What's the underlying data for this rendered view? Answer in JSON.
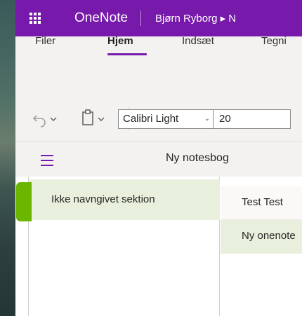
{
  "window": {
    "app_name": "OneNote",
    "breadcrumb": "Bjørn Ryborg ▸ N",
    "accent_color": "#7719aa",
    "section_color": "#6bb700"
  },
  "ribbon": {
    "tabs": [
      {
        "label": "Filer",
        "active": false
      },
      {
        "label": "Hjem",
        "active": true
      },
      {
        "label": "Indsæt",
        "active": false
      },
      {
        "label": "Tegni",
        "active": false
      }
    ]
  },
  "toolbar": {
    "undo_icon": "undo-icon",
    "paste_icon": "clipboard-icon",
    "font_name": "Calibri Light",
    "font_size": "20"
  },
  "navigation": {
    "notebook_name": "Ny notesbog",
    "sections": [
      {
        "label": "Ikke navngivet sektion",
        "selected": true
      }
    ],
    "pages": [
      {
        "label": "Test Test"
      },
      {
        "label": "Ny onenote"
      }
    ]
  }
}
